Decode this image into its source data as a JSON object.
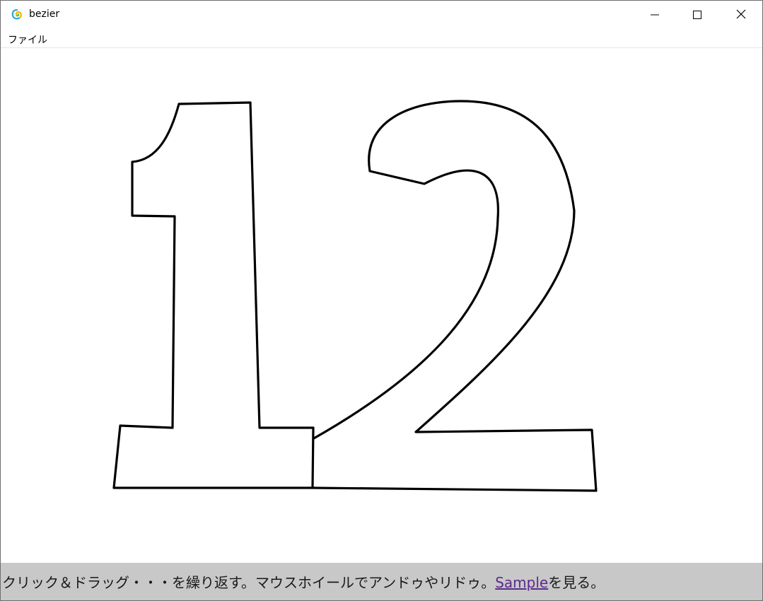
{
  "window": {
    "title": "bezier",
    "icon": "app-swirl-icon"
  },
  "controls": {
    "minimize_icon": "minimize-icon",
    "maximize_icon": "maximize-icon",
    "close_icon": "close-icon"
  },
  "menu": {
    "items": [
      {
        "label": "ファイル"
      }
    ]
  },
  "canvas": {
    "stroke_color": "#000000",
    "background_color": "#ffffff",
    "digits": [
      "1",
      "2"
    ]
  },
  "status": {
    "message": "クリック＆ドラッグ・・・を繰り返す。マウスホイールでアンドゥやリドゥ。",
    "link_text": "Sample",
    "suffix": "を見る。",
    "link_color": "#5b2a8c",
    "background_color": "#c8c8c8"
  }
}
